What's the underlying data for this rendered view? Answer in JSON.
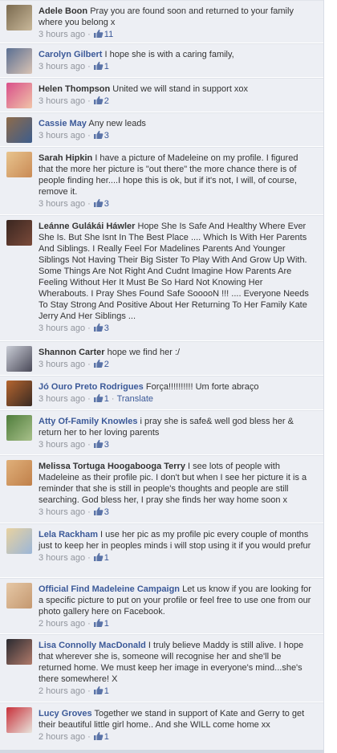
{
  "comments": [
    {
      "author": "Adele Boon",
      "author_link": false,
      "text": "Pray you are found soon and returned to your family where you belong x",
      "time": "3 hours ago",
      "likes": "11",
      "translate": null,
      "avatar_colors": [
        "#7a6a4f",
        "#c9b89a"
      ]
    },
    {
      "author": "Carolyn Gilbert",
      "author_link": true,
      "text": "I hope she is with a caring family,",
      "time": "3 hours ago",
      "likes": "1",
      "translate": null,
      "avatar_colors": [
        "#5a6f92",
        "#d9c3b4"
      ]
    },
    {
      "author": "Helen Thompson",
      "author_link": false,
      "text": "United we will stand in support xox",
      "time": "3 hours ago",
      "likes": "2",
      "translate": null,
      "avatar_colors": [
        "#d94f8a",
        "#f0c4a8"
      ]
    },
    {
      "author": "Cassie May",
      "author_link": true,
      "text": "Any new leads",
      "time": "3 hours ago",
      "likes": "3",
      "translate": null,
      "avatar_colors": [
        "#8e6b4a",
        "#3d5d8c"
      ]
    },
    {
      "author": "Sarah Hipkin",
      "author_link": false,
      "text": "I have a picture of Madeleine on my profile. I figured that the more her picture is \"out there\" the more chance there is of people finding her....I hope this is ok, but if it's not, I will, of course, remove it.",
      "time": "3 hours ago",
      "likes": "3",
      "translate": null,
      "avatar_colors": [
        "#e8c48e",
        "#c98a55"
      ]
    },
    {
      "author": "Leánne Gulákái Háwler",
      "author_link": false,
      "text": "Hope She Is Safe And Healthy Where Ever She Is. But She Isnt In The Best Place .... Which Is With Her Parents And Siblings. I Really Feel For Madelines Parents And Younger Siblings Not Having Their Big Sister To Play With And Grow Up With. Some Things Are Not Right And Cudnt Imagine How Parents Are Feeling Without Her It Must Be So Hard Not Knowing Her Wherabouts. I Pray Shes Found Safe SooooN !!! .... Everyone Needs To Stay Strong And Positive About Her Returning To Her Family Kate Jerry And Her Siblings ...",
      "time": "3 hours ago",
      "likes": "3",
      "translate": null,
      "avatar_colors": [
        "#3a2620",
        "#7a4a3a"
      ]
    },
    {
      "author": "Shannon Carter",
      "author_link": false,
      "text": "hope we find her :/",
      "time": "3 hours ago",
      "likes": "2",
      "translate": null,
      "avatar_colors": [
        "#c9ccd6",
        "#4a4a58"
      ]
    },
    {
      "author": "Jó Ouro Preto Rodrigues",
      "author_link": true,
      "text": "Força!!!!!!!!!! Um forte abraço",
      "time": "3 hours ago",
      "likes": "1",
      "translate": "Translate",
      "avatar_colors": [
        "#b5652f",
        "#3a2a22"
      ]
    },
    {
      "author": "Atty Of-Family Knowles",
      "author_link": true,
      "text": "i pray she is safe& well god bless her & return her to her loving parents",
      "time": "3 hours ago",
      "likes": "3",
      "translate": null,
      "avatar_colors": [
        "#4f7d3c",
        "#a8c08a"
      ]
    },
    {
      "author": "Melissa Tortuga Hoogabooga Terry",
      "author_link": false,
      "text": "I see lots of people with Madeleine as their profile pic. I don't but when I see her picture it is a reminder that she is still in people's thoughts and people are still searching. God bless her, I pray she finds her way home soon x",
      "time": "3 hours ago",
      "likes": "3",
      "translate": null,
      "avatar_colors": [
        "#e0b07a",
        "#c0804a"
      ]
    },
    {
      "author": "Lela Rackham",
      "author_link": true,
      "text": "I use her pic as my profile pic every couple of months just to keep her in peoples minds i will stop using it if you would prefur",
      "time": "3 hours ago",
      "likes": "1",
      "translate": null,
      "avatar_colors": [
        "#e8d2a0",
        "#9bb6d8"
      ]
    },
    {
      "author": "Official Find Madeleine Campaign",
      "author_link": true,
      "text": "Let us know if you are looking for a specific picture to put on your profile or feel free to use one from our photo gallery here on Facebook.",
      "time": "2 hours ago",
      "likes": "1",
      "translate": null,
      "avatar_colors": [
        "#e6c8a6",
        "#c49870"
      ]
    },
    {
      "author": "Lisa Connolly MacDonald",
      "author_link": true,
      "text": "I truly believe Maddy is still alive. I hope that wherever she is, someone will recognise her and she'll be returned home. We must keep her image in everyone's mind...she's there somewhere! X",
      "time": "2 hours ago",
      "likes": "1",
      "translate": null,
      "avatar_colors": [
        "#2a2a30",
        "#b07a6a"
      ]
    },
    {
      "author": "Lucy Groves",
      "author_link": true,
      "text": "Together we stand in support of Kate and Gerry to get their beautiful little girl home.. And she WILL come home xx",
      "time": "2 hours ago",
      "likes": "1",
      "translate": null,
      "avatar_colors": [
        "#c8303a",
        "#e8e4dc"
      ]
    }
  ]
}
